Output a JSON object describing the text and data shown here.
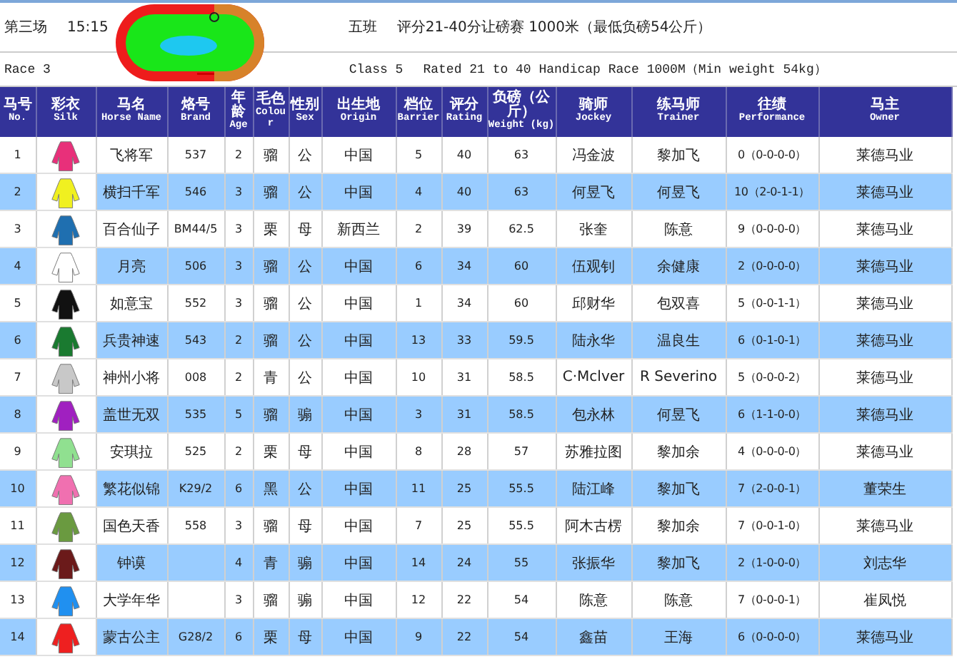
{
  "race": {
    "race_cn": "第三场",
    "time": "15:15",
    "class_cn": "五班",
    "title_cn": "评分21-40分让磅赛 1000米（最低负磅54公斤）",
    "race_en": "Race 3",
    "class_en": "Class 5",
    "title_en": "Rated 21 to 40 Handicap Race 1000M（Min weight 54kg）"
  },
  "columns": [
    {
      "cn": "马号",
      "en": "No."
    },
    {
      "cn": "彩衣",
      "en": "Silk"
    },
    {
      "cn": "马名",
      "en": "Horse Name"
    },
    {
      "cn": "烙号",
      "en": "Brand"
    },
    {
      "cn": "年龄",
      "en": "Age"
    },
    {
      "cn": "毛色",
      "en": "Colour"
    },
    {
      "cn": "性别",
      "en": "Sex"
    },
    {
      "cn": "出生地",
      "en": "Origin"
    },
    {
      "cn": "档位",
      "en": "Barrier"
    },
    {
      "cn": "评分",
      "en": "Rating"
    },
    {
      "cn": "负磅（公斤）",
      "en": "Weight (kg)"
    },
    {
      "cn": "骑师",
      "en": "Jockey"
    },
    {
      "cn": "练马师",
      "en": "Trainer"
    },
    {
      "cn": "往绩",
      "en": "Performance"
    },
    {
      "cn": "马主",
      "en": "Owner"
    }
  ],
  "rows": [
    {
      "no": "1",
      "color": "#e8307a",
      "name": "飞将军",
      "brand": "537",
      "age": "2",
      "colour": "骝",
      "sex": "公",
      "origin": "中国",
      "barrier": "5",
      "rating": "40",
      "weight": "63",
      "jockey": "冯金波",
      "trainer": "黎加飞",
      "performance": "0（0-0-0-0）",
      "owner": "莱德马业"
    },
    {
      "no": "2",
      "color": "#f0f020",
      "name": "横扫千军",
      "brand": "546",
      "age": "3",
      "colour": "骝",
      "sex": "公",
      "origin": "中国",
      "barrier": "4",
      "rating": "40",
      "weight": "63",
      "jockey": "何昱飞",
      "trainer": "何昱飞",
      "performance": "10（2-0-1-1）",
      "owner": "莱德马业"
    },
    {
      "no": "3",
      "color": "#1f6fb0",
      "name": "百合仙子",
      "brand": "BM44/5",
      "age": "3",
      "colour": "栗",
      "sex": "母",
      "origin": "新西兰",
      "barrier": "2",
      "rating": "39",
      "weight": "62.5",
      "jockey": "张奎",
      "trainer": "陈意",
      "performance": "9（0-0-0-0）",
      "owner": "莱德马业"
    },
    {
      "no": "4",
      "color": "#ffffff",
      "name": "月亮",
      "brand": "506",
      "age": "3",
      "colour": "骝",
      "sex": "公",
      "origin": "中国",
      "barrier": "6",
      "rating": "34",
      "weight": "60",
      "jockey": "伍观钊",
      "trainer": "余健康",
      "performance": "2（0-0-0-0）",
      "owner": "莱德马业"
    },
    {
      "no": "5",
      "color": "#111111",
      "name": "如意宝",
      "brand": "552",
      "age": "3",
      "colour": "骝",
      "sex": "公",
      "origin": "中国",
      "barrier": "1",
      "rating": "34",
      "weight": "60",
      "jockey": "邱财华",
      "trainer": "包双喜",
      "performance": "5（0-0-1-1）",
      "owner": "莱德马业"
    },
    {
      "no": "6",
      "color": "#1a7a30",
      "name": "兵贵神速",
      "brand": "543",
      "age": "2",
      "colour": "骝",
      "sex": "公",
      "origin": "中国",
      "barrier": "13",
      "rating": "33",
      "weight": "59.5",
      "jockey": "陆永华",
      "trainer": "温良生",
      "performance": "6（0-1-0-1）",
      "owner": "莱德马业"
    },
    {
      "no": "7",
      "color": "#c8c8c8",
      "name": "神州小将",
      "brand": "008",
      "age": "2",
      "colour": "青",
      "sex": "公",
      "origin": "中国",
      "barrier": "10",
      "rating": "31",
      "weight": "58.5",
      "jockey": "C·Mclver",
      "trainer": "R Severino",
      "performance": "5（0-0-0-2）",
      "owner": "莱德马业"
    },
    {
      "no": "8",
      "color": "#a020c0",
      "name": "盖世无双",
      "brand": "535",
      "age": "5",
      "colour": "骝",
      "sex": "骟",
      "origin": "中国",
      "barrier": "3",
      "rating": "31",
      "weight": "58.5",
      "jockey": "包永林",
      "trainer": "何昱飞",
      "performance": "6（1-1-0-0）",
      "owner": "莱德马业"
    },
    {
      "no": "9",
      "color": "#90e090",
      "name": "安琪拉",
      "brand": "525",
      "age": "2",
      "colour": "栗",
      "sex": "母",
      "origin": "中国",
      "barrier": "8",
      "rating": "28",
      "weight": "57",
      "jockey": "苏雅拉图",
      "trainer": "黎加余",
      "performance": "4（0-0-0-0）",
      "owner": "莱德马业"
    },
    {
      "no": "10",
      "color": "#f070b0",
      "name": "繁花似锦",
      "brand": "K29/2",
      "age": "6",
      "colour": "黑",
      "sex": "公",
      "origin": "中国",
      "barrier": "11",
      "rating": "25",
      "weight": "55.5",
      "jockey": "陆江峰",
      "trainer": "黎加飞",
      "performance": "7（2-0-0-1）",
      "owner": "董荣生"
    },
    {
      "no": "11",
      "color": "#6a9a40",
      "name": "国色天香",
      "brand": "558",
      "age": "3",
      "colour": "骝",
      "sex": "母",
      "origin": "中国",
      "barrier": "7",
      "rating": "25",
      "weight": "55.5",
      "jockey": "阿木古楞",
      "trainer": "黎加余",
      "performance": "7（0-0-1-0）",
      "owner": "莱德马业"
    },
    {
      "no": "12",
      "color": "#6b1a1a",
      "name": "钟谟",
      "age": "4",
      "colour": "青",
      "sex": "骟",
      "origin": "中国",
      "barrier": "14",
      "rating": "24",
      "weight": "55",
      "jockey": "张振华",
      "trainer": "黎加飞",
      "performance": "2（1-0-0-0）",
      "owner": "刘志华"
    },
    {
      "no": "13",
      "color": "#2090f0",
      "name": "大学年华",
      "age": "3",
      "colour": "骝",
      "sex": "骟",
      "origin": "中国",
      "barrier": "12",
      "rating": "22",
      "weight": "54",
      "jockey": "陈意",
      "trainer": "陈意",
      "performance": "7（0-0-0-1）",
      "owner": "崔凤悦"
    },
    {
      "no": "14",
      "color": "#ee2020",
      "name": "蒙古公主",
      "brand": "G28/2",
      "age": "6",
      "colour": "栗",
      "sex": "母",
      "origin": "中国",
      "barrier": "9",
      "rating": "22",
      "weight": "54",
      "jockey": "鑫苗",
      "trainer": "王海",
      "performance": "6（0-0-0-0）",
      "owner": "莱德马业"
    }
  ]
}
